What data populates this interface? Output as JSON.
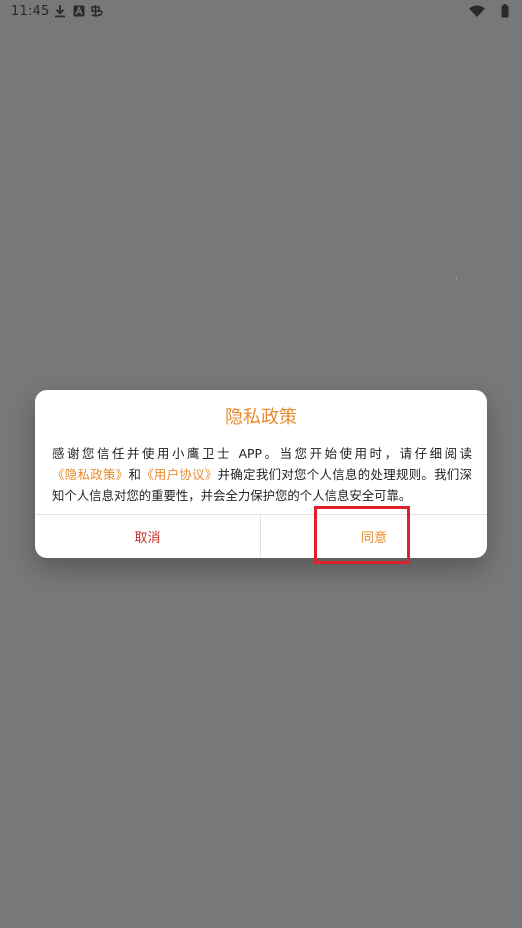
{
  "status_bar": {
    "time": "11:45",
    "icons": [
      "download-icon",
      "notification-a-icon",
      "app-notification-icon",
      "wifi-icon",
      "battery-icon"
    ]
  },
  "dialog": {
    "title": "隐私政策",
    "body": {
      "part1": "感谢您信任并使用小鹰卫士 APP。当您开始使用时，请仔细阅读",
      "privacy_link": "《隐私政策》",
      "and": "和",
      "agreement_link": "《用户协议》",
      "part2": "并确定我们对您个人信息的处理规则。我们深知个人信息对您的重要性，并会全力保护您的个人信息安全可靠。"
    },
    "cancel_label": "取消",
    "agree_label": "同意"
  },
  "colors": {
    "overlay": "#777879",
    "accent": "#e88a2e",
    "cancel": "#c9302c",
    "highlight": "#e0202a"
  }
}
